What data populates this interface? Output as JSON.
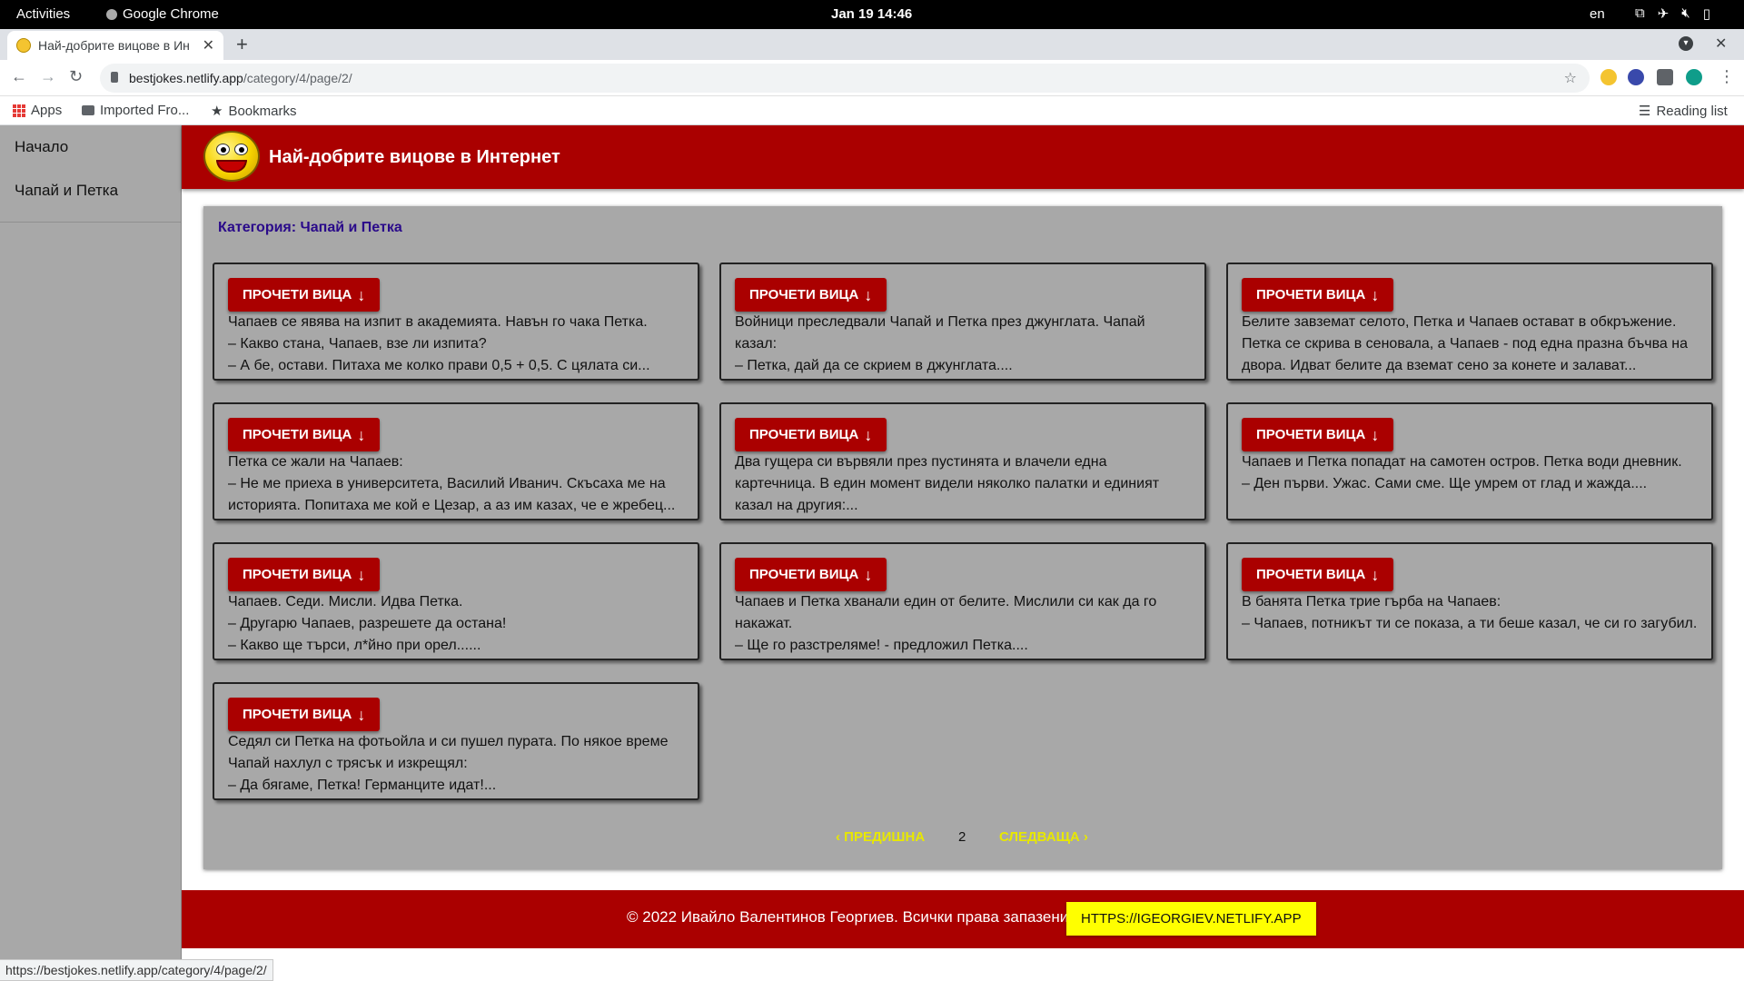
{
  "system_bar": {
    "activities": "Activities",
    "app_name": "Google Chrome",
    "clock": "Jan 19  14:46",
    "lang": "en"
  },
  "browser": {
    "tab_title": "Най-добрите вицове в Ин",
    "url_host": "bestjokes.netlify.app",
    "url_path": "/category/4/page/2/",
    "bookmarks": {
      "apps": "Apps",
      "imported": "Imported Fro...",
      "bookmarks": "Bookmarks",
      "reading_list": "Reading list"
    },
    "status_url": "https://bestjokes.netlify.app/category/4/page/2/"
  },
  "sidebar": {
    "items": [
      {
        "label": "Начало"
      },
      {
        "label": "Чапай и Петка"
      }
    ]
  },
  "header": {
    "title": "Най-добрите вицове в Интернет"
  },
  "content": {
    "category_label": "Категория: Чапай и Петка",
    "read_label": "ПРОЧЕТИ ВИЦА",
    "jokes": [
      {
        "text": "Чапаев се явява на изпит в академията. Навън го чака Петка.\n– Какво стана, Чапаев, взе ли изпита?\n– А бе, остави. Питаха ме колко прави 0,5 + 0,5. С цялата си..."
      },
      {
        "text": "Войници преследвали Чапай и Петка през джунглата. Чапай казал:\n– Петка, дай да се скрием в джунглата...."
      },
      {
        "text": "Белите завземат селото, Петка и Чапаев остават в обкръжение. Петка се скрива в сеновала, а Чапаев - под една празна бъчва на двора. Идват белите да вземат сено за конете и залават..."
      },
      {
        "text": "Петка се жали на Чапаев:\n– Не ме приеха в университета, Василий Иванич. Скъсаха ме на историята. Попитаха ме кой е Цезар, а аз им казах, че е жребец..."
      },
      {
        "text": "Два гущера си вървяли през пустинята и влачели една картечница. В един момент видели няколко палатки и единият казал на другия:..."
      },
      {
        "text": "Чапаев и Петка попадат на самотен остров. Петка води дневник.\n– Ден първи. Ужас. Сами сме. Ще умрем от глад и жажда...."
      },
      {
        "text": "Чапаев. Седи. Мисли. Идва Петка.\n– Другарю Чапаев, разрешете да остана!\n– Какво ще търси, л*йно при орел......"
      },
      {
        "text": "Чапаев и Петка хванали един от белите. Мислили си как да го накажат.\n– Ще го разстреляме! - предложил Петка...."
      },
      {
        "text": "В банята Петка трие гърба на Чапаев:\n– Чапаев, потникът ти се показа, а ти беше казал, че си го загубил."
      },
      {
        "text": "Седял си Петка на фотьойла и си пушел пурата. По някое време Чапай нахлул с трясък и изкрещял:\n– Да бягаме, Петка! Германците идат!..."
      }
    ]
  },
  "pagination": {
    "prev": "ПРЕДИШНА",
    "current": "2",
    "next": "СЛЕДВАЩА"
  },
  "footer": {
    "copyright": "© 2022 Ивайло Валентинов Георгиев. Всички права запазени.",
    "link": "HTTPS://IGEORGIEV.NETLIFY.APP"
  },
  "colors": {
    "brand_red": "#aa0000",
    "panel_gray": "#a8a8a8",
    "pager_yellow": "#e8e800",
    "footer_link_bg": "#ffff00"
  }
}
